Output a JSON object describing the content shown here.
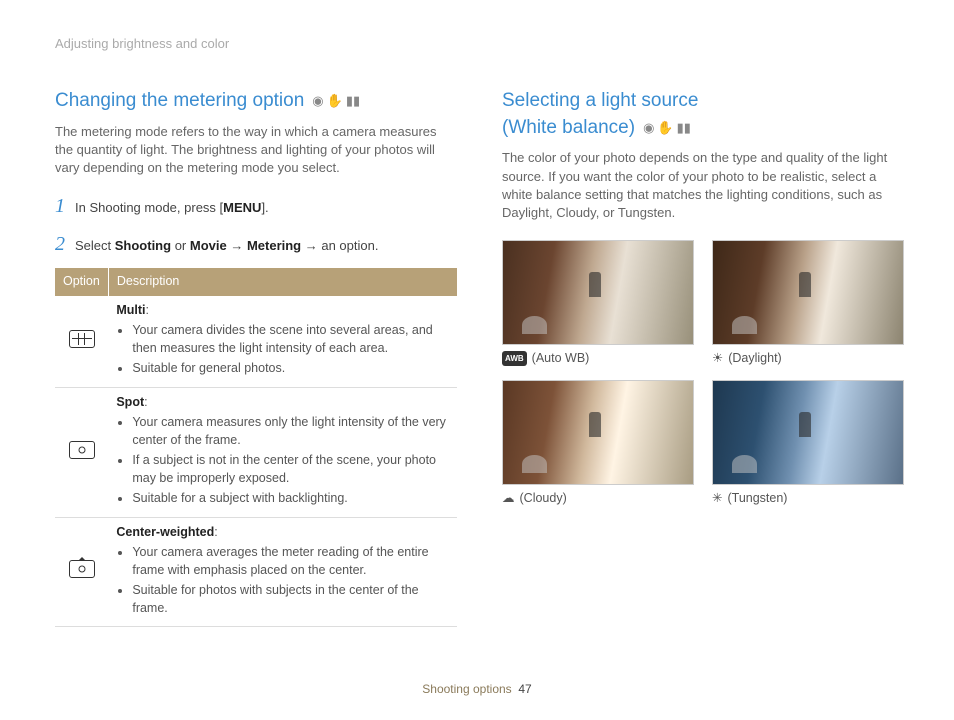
{
  "breadcrumb": "Adjusting brightness and color",
  "left": {
    "title": "Changing the metering option",
    "icons": [
      "camera-icon",
      "hand-icon",
      "video-icon"
    ],
    "intro": "The metering mode refers to the way in which a camera measures the quantity of light. The brightness and lighting of your photos will vary depending on the metering mode you select.",
    "step1_pre": "In Shooting mode, press [",
    "step1_bold": "MENU",
    "step1_post": "].",
    "step2_pre": "Select ",
    "step2_b1": "Shooting",
    "step2_mid1": " or ",
    "step2_b2": "Movie",
    "step2_mid2": " → ",
    "step2_b3": "Metering",
    "step2_post": " → an option.",
    "th_option": "Option",
    "th_desc": "Description",
    "rows": [
      {
        "name": "Multi",
        "b1": "Your camera divides the scene into several areas, and then measures the light intensity of each area.",
        "b2": "Suitable for general photos.",
        "b3": ""
      },
      {
        "name": "Spot",
        "b1": "Your camera measures only the light intensity of the very center of the frame.",
        "b2": "If a subject is not in the center of the scene, your photo may be improperly exposed.",
        "b3": "Suitable for a subject with backlighting."
      },
      {
        "name": "Center-weighted",
        "b1": "Your camera averages the meter reading of the entire frame with emphasis placed on the center.",
        "b2": "Suitable for photos with subjects in the center of the frame.",
        "b3": ""
      }
    ]
  },
  "right": {
    "title_l1": "Selecting a light source",
    "title_l2": "(White balance)",
    "icons": [
      "camera-icon",
      "hand-icon",
      "video-icon"
    ],
    "intro": "The color of your photo depends on the type and quality of the light source. If you want the color of your photo to be realistic, select a white balance setting that matches the lighting conditions, such as Daylight, Cloudy, or Tungsten.",
    "wb": [
      {
        "icon": "AWB",
        "label": "(Auto WB)"
      },
      {
        "icon": "☀",
        "label": "(Daylight)"
      },
      {
        "icon": "☁",
        "label": "(Cloudy)"
      },
      {
        "icon": "✳",
        "label": "(Tungsten)"
      }
    ]
  },
  "footer": {
    "section": "Shooting options",
    "page": "47"
  }
}
